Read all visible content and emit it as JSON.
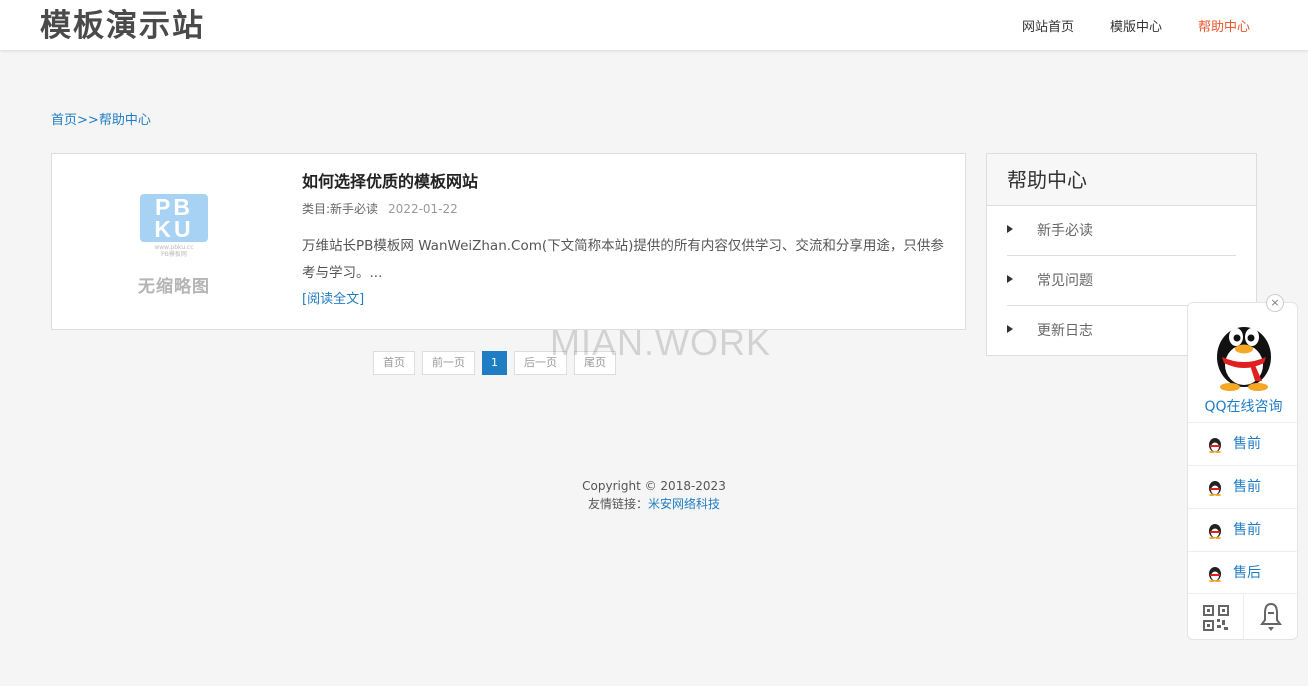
{
  "header": {
    "logo": "模板演示站",
    "nav": [
      {
        "label": "网站首页",
        "active": false
      },
      {
        "label": "模版中心",
        "active": false
      },
      {
        "label": "帮助中心",
        "active": true
      }
    ]
  },
  "breadcrumb": {
    "home": "首页",
    "sep": ">>",
    "current": "帮助中心"
  },
  "article": {
    "thumb_logo": "PBKU",
    "thumb_logo_top": "PB",
    "thumb_logo_bottom": "KU",
    "thumb_sub": "www.pbku.cc",
    "thumb_sub2": "PB模板网",
    "thumb_text": "无缩略图",
    "title": "如何选择优质的模板网站",
    "category": "类目:新手必读",
    "date": "2022-01-22",
    "description": "万维站长PB模板网 WanWeiZhan.Com(下文简称本站)提供的所有内容仅供学习、交流和分享用途，只供参考与学习。...",
    "read_more": "[阅读全文]"
  },
  "pagination": {
    "first": "首页",
    "prev": "前一页",
    "current": "1",
    "next": "后一页",
    "last": "尾页"
  },
  "watermark": "MIAN.WORK",
  "sidebar": {
    "title": "帮助中心",
    "items": [
      "新手必读",
      "常见问题",
      "更新日志"
    ]
  },
  "footer": {
    "copyright": "Copyright © 2018-2023",
    "links_label": "友情链接：",
    "link": "米安网络科技"
  },
  "qq_widget": {
    "close": "×",
    "title": "QQ在线咨询",
    "contacts": [
      "售前",
      "售前",
      "售前",
      "售后"
    ],
    "icons": [
      "qq-penguin-icon",
      "qr-code-icon",
      "bell-icon"
    ]
  },
  "colors": {
    "accent": "#1f7dc4",
    "active_nav": "#e8572e"
  }
}
